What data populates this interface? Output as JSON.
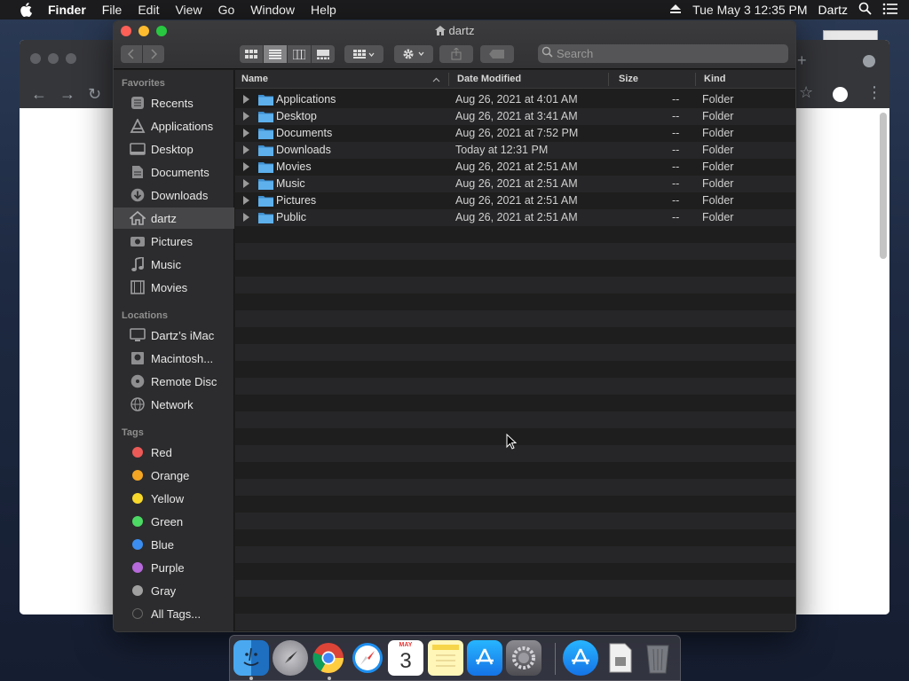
{
  "menubar": {
    "app_name": "Finder",
    "menus": [
      "File",
      "Edit",
      "View",
      "Go",
      "Window",
      "Help"
    ],
    "clock": "Tue May 3  12:35 PM",
    "user": "Dartz"
  },
  "window": {
    "title": "dartz"
  },
  "toolbar": {
    "search_placeholder": "Search"
  },
  "sidebar": {
    "favorites_header": "Favorites",
    "favorites": [
      {
        "label": "Recents",
        "icon": "clock-icon"
      },
      {
        "label": "Applications",
        "icon": "applications-icon"
      },
      {
        "label": "Desktop",
        "icon": "desktop-icon"
      },
      {
        "label": "Documents",
        "icon": "document-icon"
      },
      {
        "label": "Downloads",
        "icon": "download-icon"
      },
      {
        "label": "dartz",
        "icon": "home-icon"
      },
      {
        "label": "Pictures",
        "icon": "camera-icon"
      },
      {
        "label": "Music",
        "icon": "music-note-icon"
      },
      {
        "label": "Movies",
        "icon": "film-icon"
      }
    ],
    "locations_header": "Locations",
    "locations": [
      {
        "label": "Dartz’s iMac",
        "icon": "imac-icon"
      },
      {
        "label": "Macintosh...",
        "icon": "hard-disk-icon"
      },
      {
        "label": "Remote Disc",
        "icon": "disc-icon"
      },
      {
        "label": "Network",
        "icon": "globe-icon"
      }
    ],
    "tags_header": "Tags",
    "tags": [
      {
        "label": "Red",
        "color": "#ec5a57"
      },
      {
        "label": "Orange",
        "color": "#f5a623"
      },
      {
        "label": "Yellow",
        "color": "#f8d82a"
      },
      {
        "label": "Green",
        "color": "#4cd964"
      },
      {
        "label": "Blue",
        "color": "#3b8ef0"
      },
      {
        "label": "Purple",
        "color": "#b76adb"
      },
      {
        "label": "Gray",
        "color": "#a0a0a0"
      },
      {
        "label": "All Tags...",
        "color": "#555555"
      }
    ]
  },
  "list": {
    "headers": {
      "name": "Name",
      "date": "Date Modified",
      "size": "Size",
      "kind": "Kind"
    },
    "rows": [
      {
        "name": "Applications",
        "date": "Aug 26, 2021 at 4:01 AM",
        "size": "--",
        "kind": "Folder"
      },
      {
        "name": "Desktop",
        "date": "Aug 26, 2021 at 3:41 AM",
        "size": "--",
        "kind": "Folder"
      },
      {
        "name": "Documents",
        "date": "Aug 26, 2021 at 7:52 PM",
        "size": "--",
        "kind": "Folder"
      },
      {
        "name": "Downloads",
        "date": "Today at 12:31 PM",
        "size": "--",
        "kind": "Folder"
      },
      {
        "name": "Movies",
        "date": "Aug 26, 2021 at 2:51 AM",
        "size": "--",
        "kind": "Folder"
      },
      {
        "name": "Music",
        "date": "Aug 26, 2021 at 2:51 AM",
        "size": "--",
        "kind": "Folder"
      },
      {
        "name": "Pictures",
        "date": "Aug 26, 2021 at 2:51 AM",
        "size": "--",
        "kind": "Folder"
      },
      {
        "name": "Public",
        "date": "Aug 26, 2021 at 2:51 AM",
        "size": "--",
        "kind": "Folder"
      }
    ]
  },
  "dock": {
    "apps": [
      "finder-icon",
      "launchpad-icon",
      "chrome-icon",
      "safari-icon",
      "calendar-icon",
      "notes-icon",
      "app-store-icon",
      "system-preferences-icon",
      "app-store-downloads-icon",
      "documents-stack-icon",
      "trash-icon"
    ],
    "calendar_month": "MAY",
    "calendar_day": "3"
  },
  "colors": {
    "folder_blue": "#4fa3e0",
    "accent": "#2f7fd8"
  }
}
